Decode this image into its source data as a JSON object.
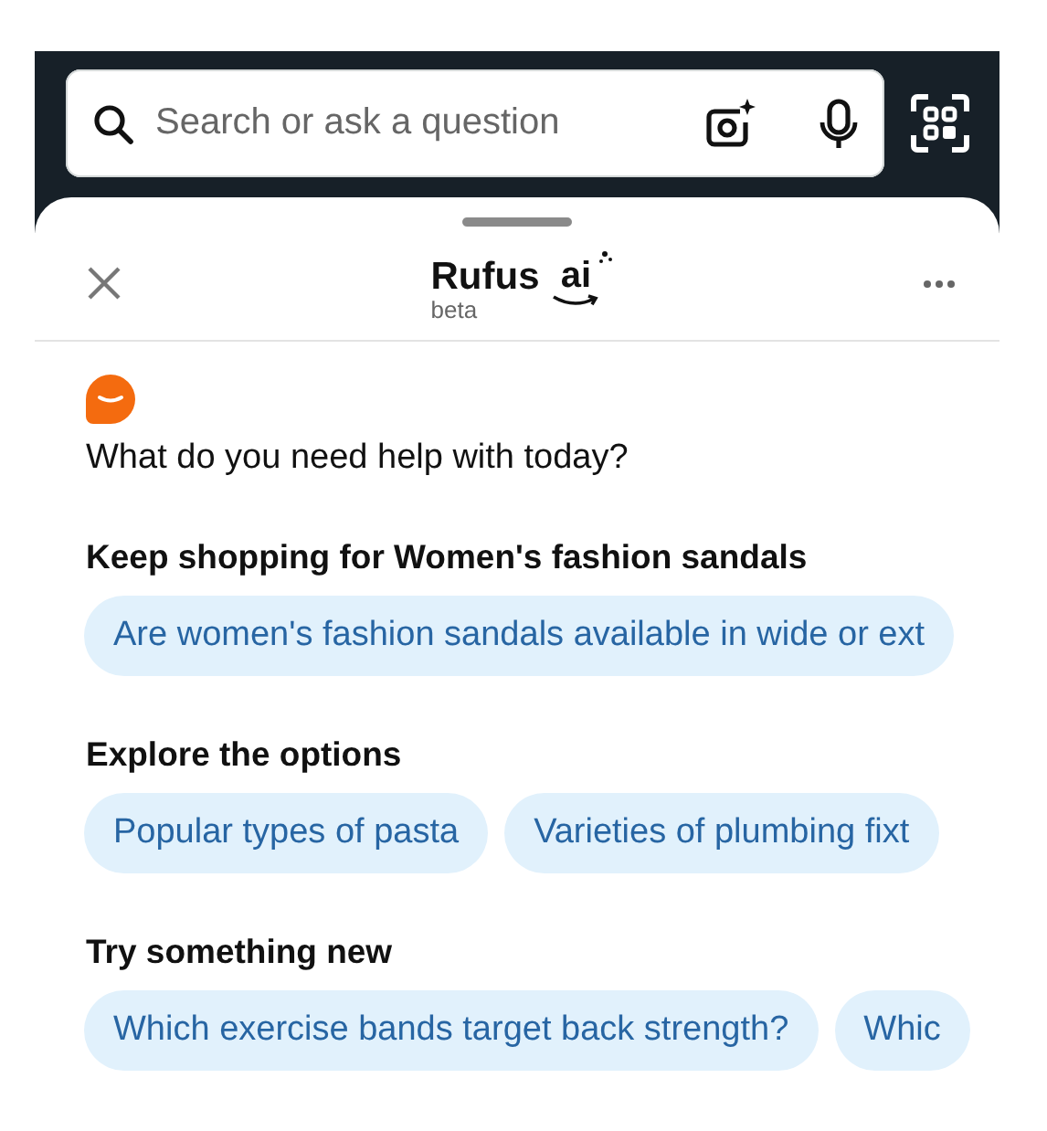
{
  "search": {
    "placeholder": "Search or ask a question"
  },
  "sheet": {
    "title": "Rufus",
    "logo_text": "ai",
    "badge": "beta"
  },
  "greeting": "What do you need help with today?",
  "sections": [
    {
      "title": "Keep shopping for Women's fashion sandals",
      "suggestions": [
        "Are women's fashion sandals available in wide or ext"
      ]
    },
    {
      "title": "Explore the options",
      "suggestions": [
        "Popular types of pasta",
        "Varieties of plumbing fixt"
      ]
    },
    {
      "title": "Try something new",
      "suggestions": [
        "Which exercise bands target back strength?",
        "Whic"
      ]
    }
  ]
}
